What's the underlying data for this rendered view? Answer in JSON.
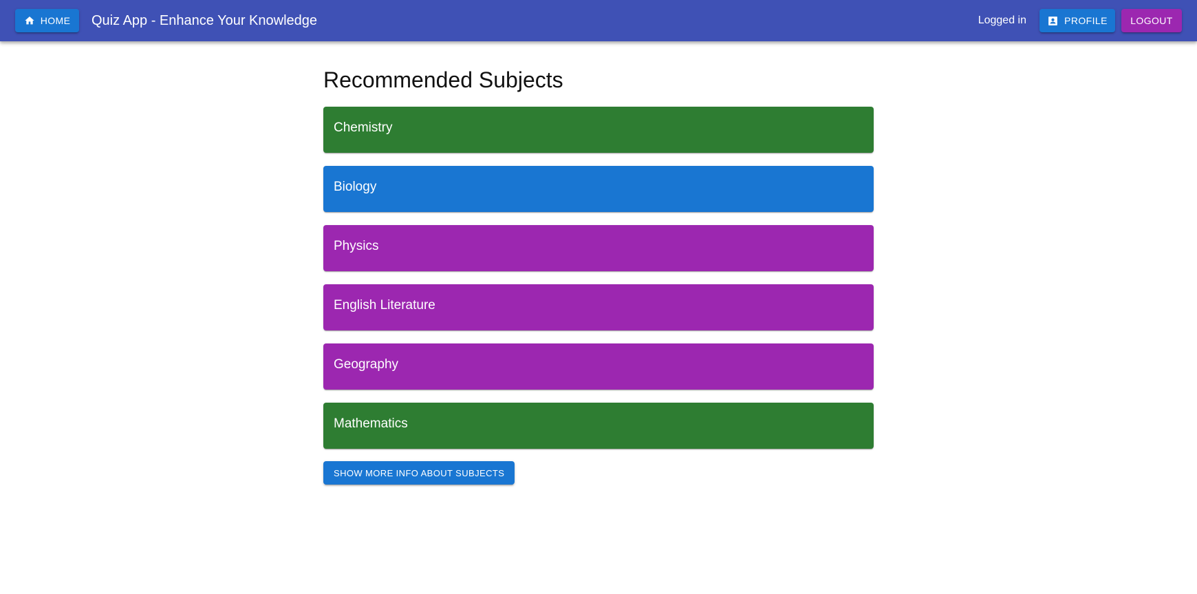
{
  "header": {
    "home_label": "HOME",
    "title": "Quiz App - Enhance Your Knowledge",
    "status": "Logged in",
    "profile_label": "PROFILE",
    "logout_label": "LOGOUT",
    "background_color": "#3f51b5"
  },
  "main": {
    "title": "Recommended Subjects",
    "subjects": [
      {
        "label": "Chemistry",
        "color": "#2e7d32"
      },
      {
        "label": "Biology",
        "color": "#1976d2"
      },
      {
        "label": "Physics",
        "color": "#9c27b0"
      },
      {
        "label": "English Literature",
        "color": "#9c27b0"
      },
      {
        "label": "Geography",
        "color": "#9c27b0"
      },
      {
        "label": "Mathematics",
        "color": "#2e7d32"
      }
    ],
    "more_button_label": "SHOW MORE INFO ABOUT SUBJECTS"
  },
  "icons": {
    "home": "home-icon",
    "profile": "contact-card-icon"
  }
}
